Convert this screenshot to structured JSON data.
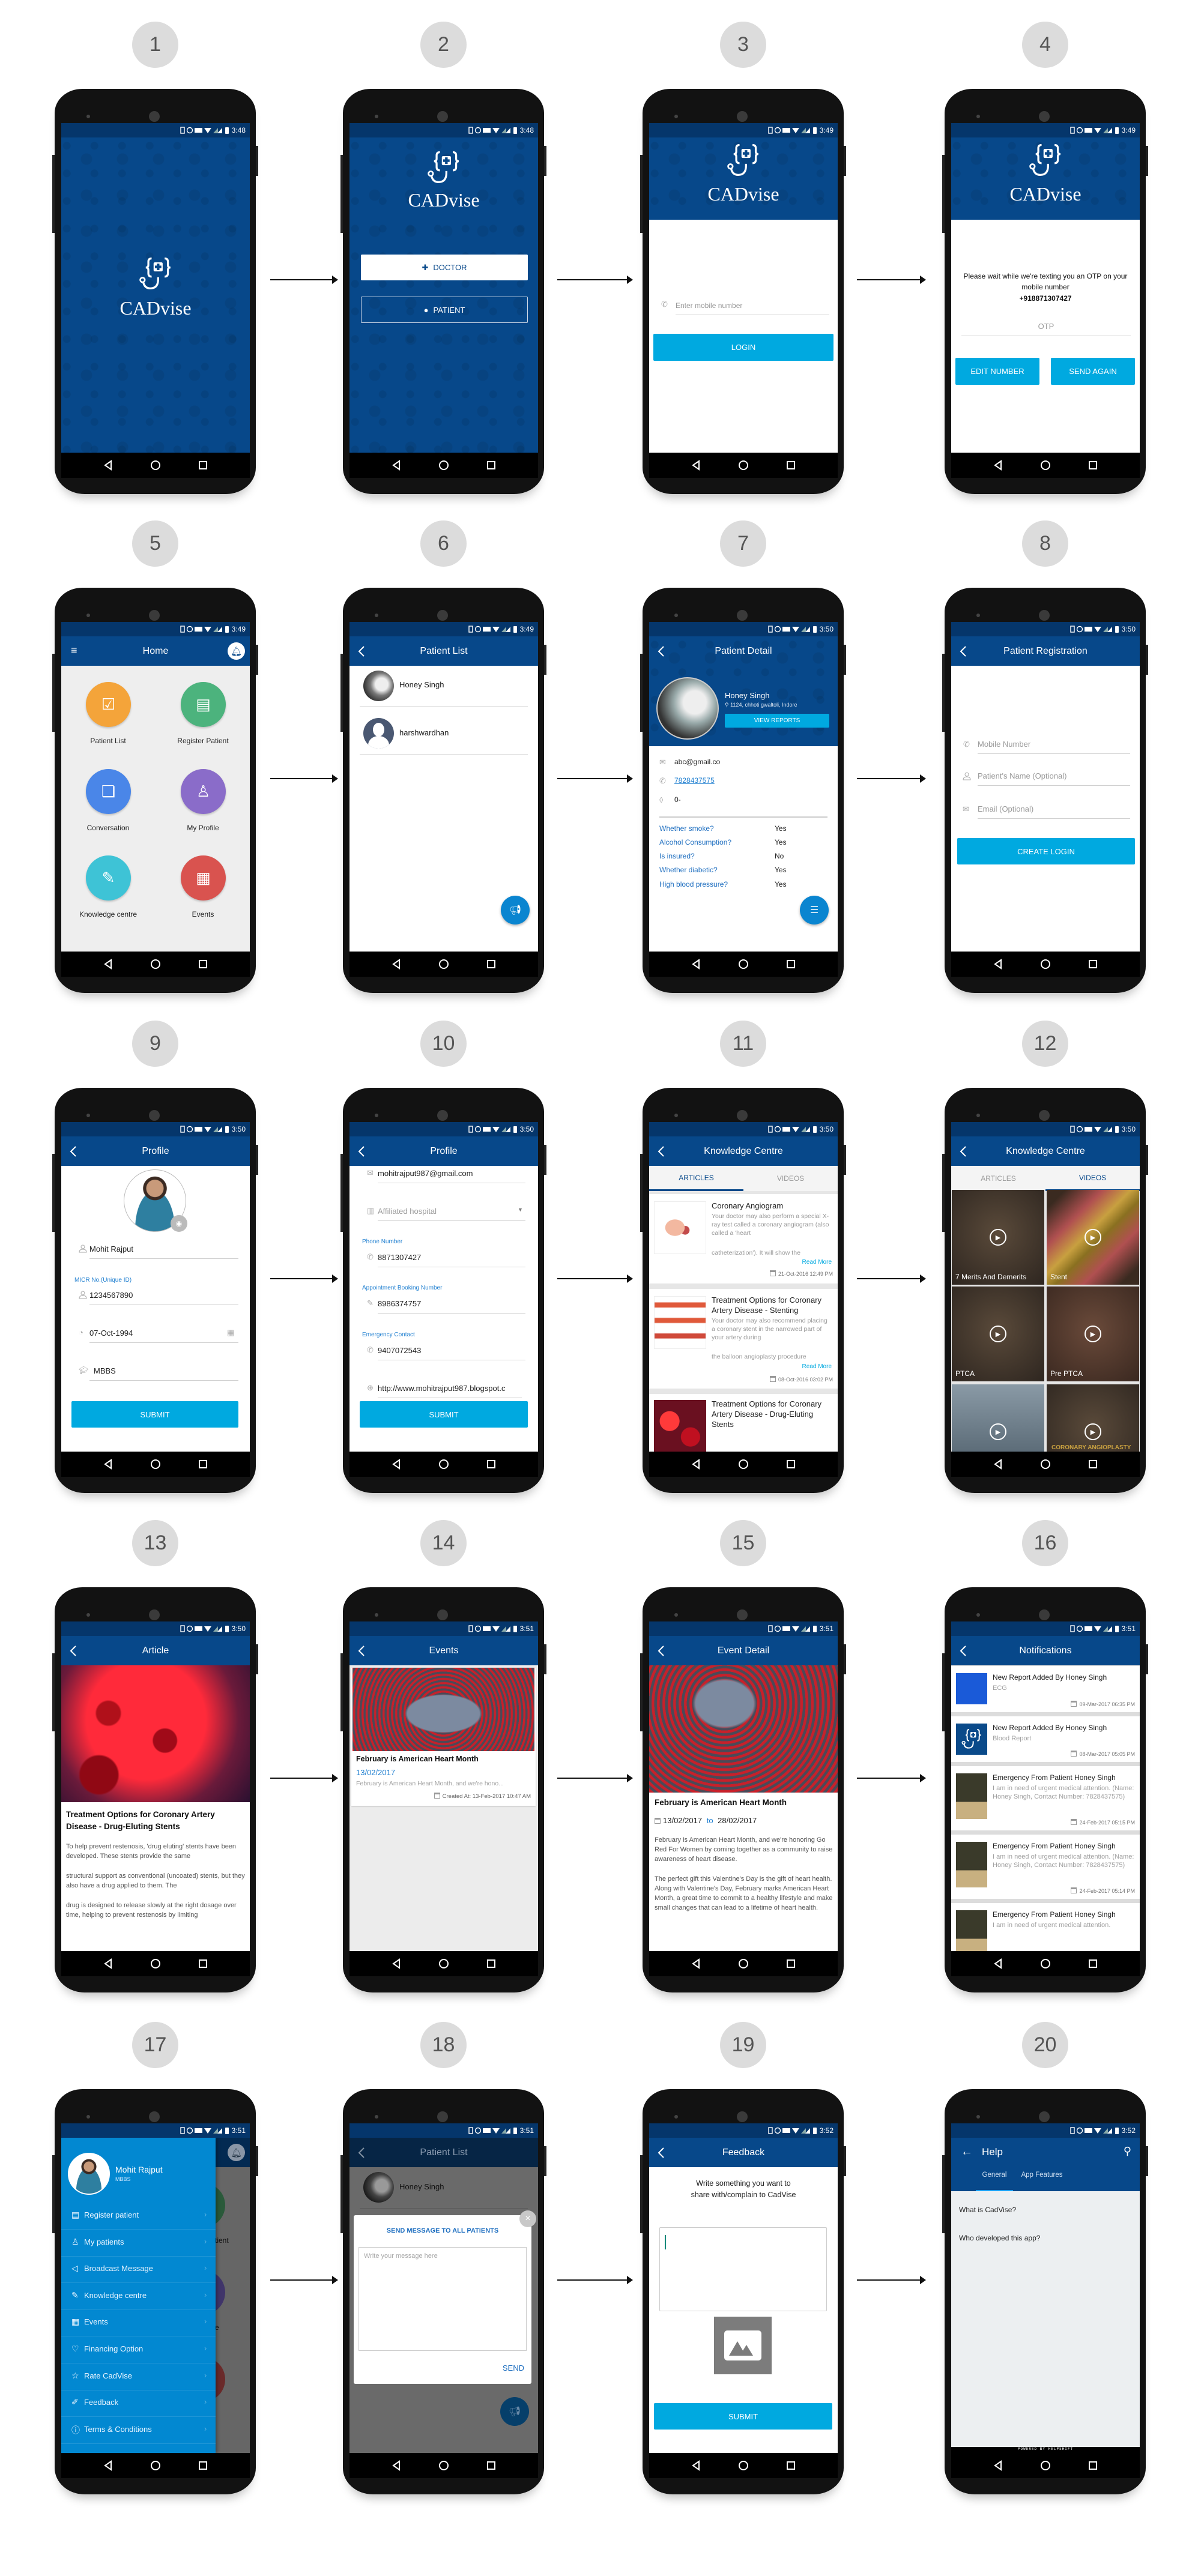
{
  "colors": {
    "primary": "#07488a",
    "status_bar": "#05366b",
    "accent": "#00a9e0",
    "drawer": "#0288d1",
    "step_circle": "#dcdcdc"
  },
  "screens": [
    {
      "number": "1",
      "time": "3:48"
    },
    {
      "number": "2",
      "time": "3:48"
    },
    {
      "number": "3",
      "time": "3:49"
    },
    {
      "number": "4",
      "time": "3:49"
    },
    {
      "number": "5",
      "time": "3:49"
    },
    {
      "number": "6",
      "time": "3:49"
    },
    {
      "number": "7",
      "time": "3:50"
    },
    {
      "number": "8",
      "time": "3:50"
    },
    {
      "number": "9",
      "time": "3:50"
    },
    {
      "number": "10",
      "time": "3:50"
    },
    {
      "number": "11",
      "time": "3:50"
    },
    {
      "number": "12",
      "time": "3:50"
    },
    {
      "number": "13",
      "time": "3:50"
    },
    {
      "number": "14",
      "time": "3:51"
    },
    {
      "number": "15",
      "time": "3:51"
    },
    {
      "number": "16",
      "time": "3:51"
    },
    {
      "number": "17",
      "time": "3:51"
    },
    {
      "number": "18",
      "time": "3:51"
    },
    {
      "number": "19",
      "time": "3:52"
    },
    {
      "number": "20",
      "time": "3:52"
    }
  ],
  "brand": {
    "name": "CADvise",
    "logo_icon": "stethoscope-braces-cross"
  },
  "s2": {
    "doctor": "DOCTOR",
    "patient": "PATIENT"
  },
  "s3": {
    "mobile_placeholder": "Enter mobile number",
    "login": "LOGIN"
  },
  "s4": {
    "message": "Please wait while we're texting you an OTP on your mobile number",
    "phone": "+918871307427",
    "otp_placeholder": "OTP",
    "edit": "EDIT NUMBER",
    "resend": "SEND AGAIN"
  },
  "s5": {
    "title": "Home",
    "tiles": [
      {
        "label": "Patient List",
        "color": "#f4a43a",
        "icon": "clipboard-icon"
      },
      {
        "label": "Register Patient",
        "color": "#4cb37d",
        "icon": "register-icon"
      },
      {
        "label": "Conversation",
        "color": "#4a86e8",
        "icon": "chat-icon"
      },
      {
        "label": "My Profile",
        "color": "#8a6cc9",
        "icon": "profile-icon"
      },
      {
        "label": "Knowledge centre",
        "color": "#3ec3d6",
        "icon": "document-pen-icon"
      },
      {
        "label": "Events",
        "color": "#d9534f",
        "icon": "calendar-icon"
      }
    ]
  },
  "s6": {
    "title": "Patient List",
    "patients": [
      "Honey Singh",
      "harshwardhan"
    ]
  },
  "s7": {
    "title": "Patient Detail",
    "name": "Honey Singh",
    "address": "1124, chhoti gwaltoli, Indore",
    "view_reports": "VIEW REPORTS",
    "email": "abc@gmail.co",
    "phone": "7828437575",
    "blood_group": "0-",
    "questions": [
      {
        "q": "Whether smoke?",
        "a": "Yes"
      },
      {
        "q": "Alcohol Consumption?",
        "a": "Yes"
      },
      {
        "q": "Is insured?",
        "a": "No"
      },
      {
        "q": "Whether diabetic?",
        "a": "Yes"
      },
      {
        "q": "High blood pressure?",
        "a": "Yes"
      }
    ]
  },
  "s8": {
    "title": "Patient Registration",
    "mobile_placeholder": "Mobile Number",
    "name_placeholder": "Patient's Name (Optional)",
    "email_placeholder": "Email (Optional)",
    "create_login": "CREATE LOGIN"
  },
  "s9": {
    "title": "Profile",
    "name": "Mohit Rajput",
    "micr_label": "MICR No.(Unique ID)",
    "micr": "1234567890",
    "dob": "07-Oct-1994",
    "degree": "MBBS",
    "submit": "SUBMIT"
  },
  "s10": {
    "title": "Profile",
    "email": "mohitrajput987@gmail.com",
    "hospital_placeholder": "Affiliated hospital",
    "phone_label": "Phone Number",
    "phone": "8871307427",
    "appt_label": "Appointment Booking Number",
    "appt": "8986374757",
    "emergency_label": "Emergency Contact",
    "emergency": "9407072543",
    "website": "http://www.mohitrajput987.blogspot.c",
    "submit": "SUBMIT"
  },
  "s11": {
    "title": "Knowledge Centre",
    "tabs": [
      "ARTICLES",
      "VIDEOS"
    ],
    "articles": [
      {
        "title": "Coronary Angiogram",
        "excerpt": "Your doctor may also perform a special X-ray test called a coronary angiogram (also called a 'heart",
        "excerpt2": "catheterization'). It will show the",
        "read_more": "Read More",
        "date": "21-Oct-2016 12:49 PM"
      },
      {
        "title": "Treatment Options for Coronary Artery Disease - Stenting",
        "excerpt": "Your doctor may also recommend placing a coronary stent in the narrowed part of your artery during",
        "excerpt2": "the balloon angioplasty procedure",
        "read_more": "Read More",
        "date": "08-Oct-2016 03:02 PM"
      },
      {
        "title": "Treatment Options for Coronary Artery Disease - Drug-Eluting Stents"
      }
    ]
  },
  "s12": {
    "title": "Knowledge Centre",
    "tabs": [
      "ARTICLES",
      "VIDEOS"
    ],
    "videos": [
      "7 Merits And Demerits",
      "Stent",
      "PTCA",
      "Pre PTCA",
      "",
      ""
    ],
    "thumb_caption": "CORONARY ANGIOPLASTY"
  },
  "s13": {
    "title": "Article",
    "heading": "Treatment Options for Coronary Artery Disease - Drug-Eluting Stents",
    "paragraphs": [
      "To help prevent restenosis, 'drug eluting' stents have been developed. These stents provide the same",
      "structural support as conventional (uncoated) stents, but they also have a drug applied to them. The",
      "drug is designed to release slowly at the right dosage over time, helping to prevent restenosis by limiting"
    ]
  },
  "s14": {
    "title": "Events",
    "event_title": "February is American Heart Month",
    "date": "13/02/2017",
    "excerpt": "February is American Heart Month, and we're hono...",
    "created": "Created At: 13-Feb-2017 10:47 AM"
  },
  "s15": {
    "title": "Event Detail",
    "heading": "February is American Heart Month",
    "start": "13/02/2017",
    "to": "to",
    "end": "28/02/2017",
    "paragraphs": [
      "February is American Heart Month, and we're honoring Go Red For Women by coming together as a community to raise awareness of heart disease.",
      "The perfect gift this Valentine's Day is the gift of heart health. Along with Valentine's Day, February marks American Heart Month, a great time to commit to a healthy lifestyle and make small changes that can lead to a lifetime of heart health."
    ]
  },
  "s16": {
    "title": "Notifications",
    "items": [
      {
        "title": "New Report Added By Honey Singh",
        "body": "ECG",
        "date": "09-Mar-2017 06:35 PM"
      },
      {
        "title": "New Report Added By Honey Singh",
        "body": "Blood Report",
        "date": "08-Mar-2017 05:05 PM"
      },
      {
        "title": "Emergency From Patient Honey Singh",
        "body": "I am in need of urgent medical attention. (Name: Honey Singh, Contact Number: 7828437575)",
        "date": "24-Feb-2017 05:15 PM"
      },
      {
        "title": "Emergency From Patient Honey Singh",
        "body": "I am in need of urgent medical attention. (Name: Honey Singh, Contact Number: 7828437575)",
        "date": "24-Feb-2017 05:14 PM"
      },
      {
        "title": "Emergency From Patient Honey Singh",
        "body": "I am in need of urgent medical attention."
      }
    ]
  },
  "s17": {
    "name": "Mohit Rajput",
    "degree": "MBBS",
    "items": [
      {
        "label": "Register patient",
        "icon": "register-icon"
      },
      {
        "label": "My patients",
        "icon": "person-icon"
      },
      {
        "label": "Broadcast Message",
        "icon": "megaphone-icon"
      },
      {
        "label": "Knowledge centre",
        "icon": "document-pen-icon"
      },
      {
        "label": "Events",
        "icon": "calendar-icon"
      },
      {
        "label": "Financing Option",
        "icon": "heart-icon"
      },
      {
        "label": "Rate CadVise",
        "icon": "star-icon"
      },
      {
        "label": "Feedback",
        "icon": "feedback-icon"
      },
      {
        "label": "Terms & Conditions",
        "icon": "info-icon"
      }
    ]
  },
  "s18": {
    "title": "Patient List",
    "patient": "Honey Singh",
    "dialog_title": "SEND MESSAGE TO ALL PATIENTS",
    "placeholder": "Write your message here",
    "send": "SEND"
  },
  "s19": {
    "title": "Feedback",
    "prompt": "Write something you want to share with/complain to CadVise",
    "submit": "SUBMIT"
  },
  "s20": {
    "title": "Help",
    "tabs": [
      "General",
      "App Features"
    ],
    "questions": [
      "What is CadVise?",
      "Who developed this app?"
    ],
    "footer": "POWERED BY HELPSHIFT"
  }
}
